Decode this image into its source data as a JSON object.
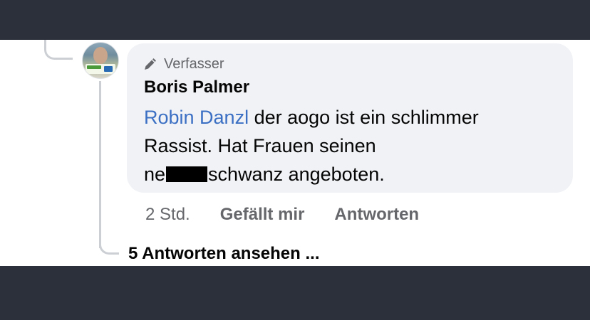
{
  "comment": {
    "role_label": "Verfasser",
    "author": "Boris Palmer",
    "mention": "Robin Danzl",
    "text_line1": " der aogo ist ein schlimmer",
    "text_line2": "Rassist. Hat Frauen seinen",
    "text_line3_before": "ne",
    "text_line3_after": "schwanz angeboten.",
    "time": "2 Std.",
    "like_label": "Gefällt mir",
    "reply_label": "Antworten"
  },
  "replies": {
    "view_label": "5 Antworten ansehen ..."
  },
  "icons": {
    "role_icon": "pencil-icon",
    "avatar": "avatar"
  },
  "colors": {
    "background": "#2b303b",
    "panel": "#ffffff",
    "bubble": "#f0f2f5",
    "mention": "#3b6fc4",
    "meta": "#65676b",
    "text": "#050505"
  }
}
